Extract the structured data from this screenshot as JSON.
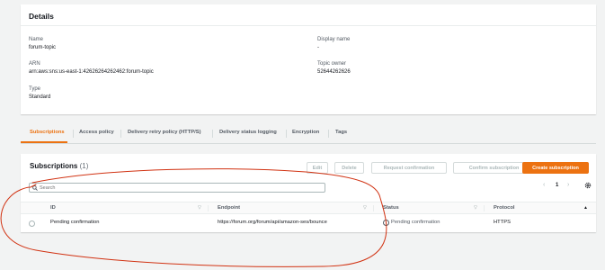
{
  "details": {
    "title": "Details",
    "name_label": "Name",
    "name_value": "forum-topic",
    "arn_label": "ARN",
    "arn_value": "arn:aws:sns:us-east-1:42626264262462:forum-topic",
    "type_label": "Type",
    "type_value": "Standard",
    "display_name_label": "Display name",
    "display_name_value": "-",
    "topic_owner_label": "Topic owner",
    "topic_owner_value": "52644262626"
  },
  "tabs": [
    {
      "label": "Subscriptions",
      "active": true
    },
    {
      "label": "Access policy"
    },
    {
      "label": "Delivery retry policy (HTTP/S)"
    },
    {
      "label": "Delivery status logging"
    },
    {
      "label": "Encryption"
    },
    {
      "label": "Tags"
    }
  ],
  "subscriptions": {
    "title": "Subscriptions",
    "count": "(1)",
    "buttons": {
      "edit": "Edit",
      "delete": "Delete",
      "request_confirmation": "Request confirmation",
      "confirm_subscription": "Confirm subscription",
      "create_subscription": "Create subscription"
    },
    "search_placeholder": "Search",
    "pager": {
      "prev": "‹",
      "page": "1",
      "next": "›"
    },
    "settings_icon": "gear-icon",
    "columns": [
      "ID",
      "Endpoint",
      "Status",
      "Protocol"
    ],
    "rows": [
      {
        "id": "Pending confirmation",
        "endpoint": "https://forum.org/forum/api/amazon-ses/bounce",
        "status": "Pending confirmation",
        "protocol": "HTTPS"
      }
    ]
  },
  "colors": {
    "accent": "#ec7211",
    "annotation": "#d13212"
  }
}
